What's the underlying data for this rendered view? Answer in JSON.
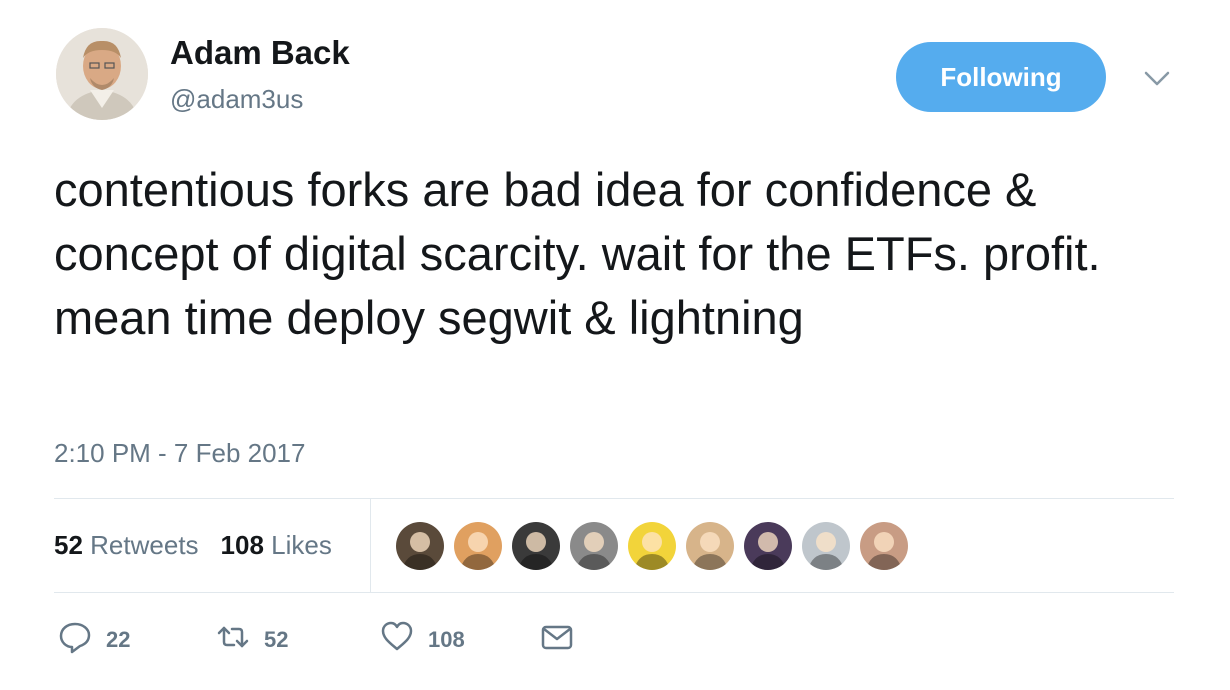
{
  "user": {
    "name": "Adam Back",
    "handle": "@adam3us",
    "follow_label": "Following"
  },
  "tweet": {
    "text": "contentious forks are bad idea for confidence & concept of digital scarcity. wait for the ETFs. profit. mean time deploy segwit & lightning",
    "timestamp": "2:10 PM - 7 Feb 2017"
  },
  "stats": {
    "retweets_count": "52",
    "retweets_label": "Retweets",
    "likes_count": "108",
    "likes_label": "Likes"
  },
  "likers": [
    {
      "icon": "avatar-1",
      "color": "#5a4a3a"
    },
    {
      "icon": "avatar-2",
      "color": "#e0a060"
    },
    {
      "icon": "avatar-3",
      "color": "#3a3a3a"
    },
    {
      "icon": "avatar-4",
      "color": "#8a8a8a"
    },
    {
      "icon": "avatar-5",
      "color": "#f2d43a"
    },
    {
      "icon": "avatar-6",
      "color": "#d7b48a"
    },
    {
      "icon": "avatar-7",
      "color": "#4a3a5a"
    },
    {
      "icon": "avatar-8",
      "color": "#bfc6cc"
    },
    {
      "icon": "avatar-9",
      "color": "#c89c84"
    }
  ],
  "actions": {
    "reply_count": "22",
    "retweet_count": "52",
    "like_count": "108"
  },
  "colors": {
    "accent": "#55acee",
    "secondary_text": "#657786",
    "divider": "#e1e8ed"
  }
}
